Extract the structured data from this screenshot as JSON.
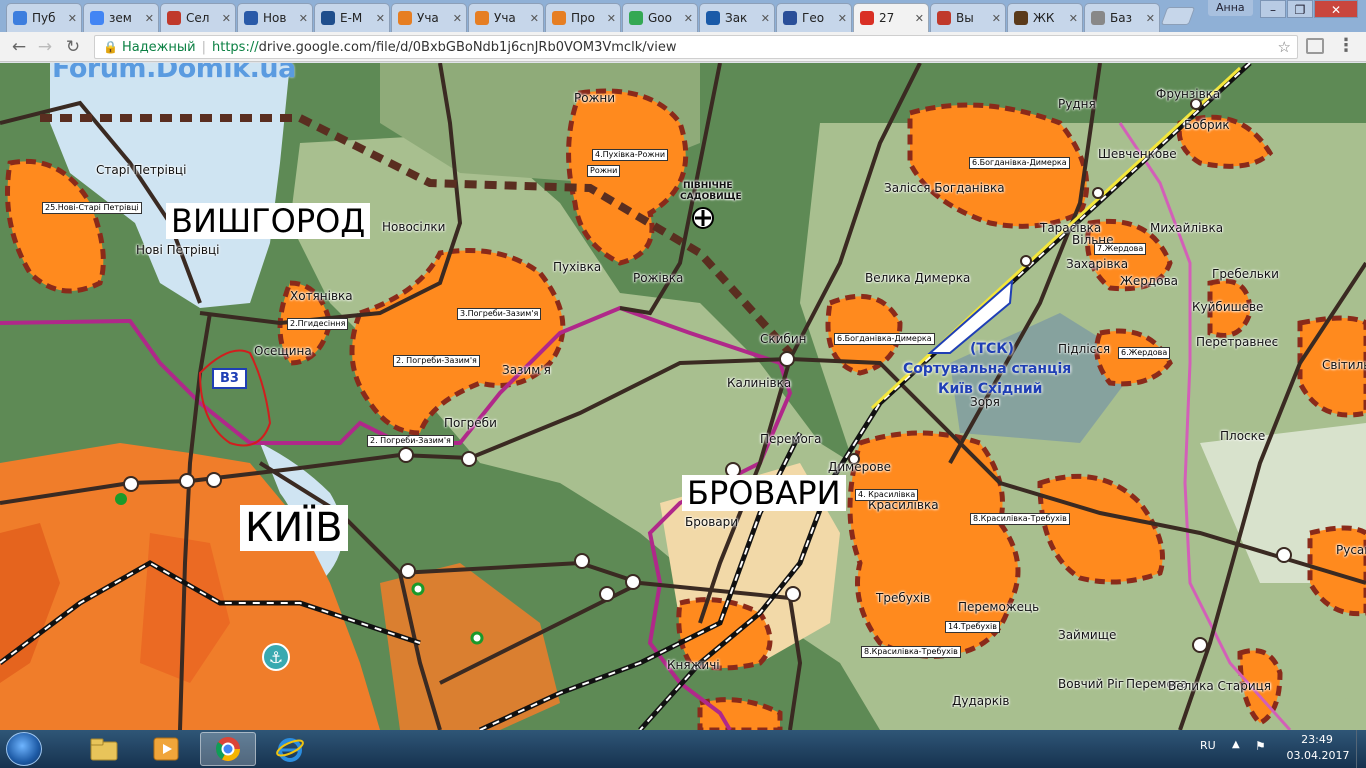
{
  "browser": {
    "tabs": [
      {
        "label": "Пуб",
        "color": "#3d7ede"
      },
      {
        "label": "зем",
        "color": "#4285f4"
      },
      {
        "label": "Сел",
        "color": "#c0392b"
      },
      {
        "label": "Нов",
        "color": "#2a5aa8"
      },
      {
        "label": "E-M",
        "color": "#1f4e8c"
      },
      {
        "label": "Уча",
        "color": "#e67e22"
      },
      {
        "label": "Уча",
        "color": "#e67e22"
      },
      {
        "label": "Про",
        "color": "#e67e22"
      },
      {
        "label": "Goo",
        "color": "#34a853"
      },
      {
        "label": "Зак",
        "color": "#1a5aa8"
      },
      {
        "label": "Гео",
        "color": "#2a4f99"
      },
      {
        "label": "27",
        "color": "#d93025"
      },
      {
        "label": "Вы",
        "color": "#c0392b"
      },
      {
        "label": "ЖК",
        "color": "#5a3a1a"
      },
      {
        "label": "Баз",
        "color": "#888888"
      }
    ],
    "active_tab": 11,
    "user": "Анна",
    "window_controls": {
      "minimize": "–",
      "restore": "❐",
      "close": "✕"
    },
    "security_label": "Надежный",
    "url_scheme": "https://",
    "url_rest": "drive.google.com/file/d/0BxbGBoNdb1j6cnJRb0VOM3Vmclk/view",
    "icons": {
      "back": "back-arrow-icon",
      "forward": "forward-arrow-icon",
      "reload": "reload-icon",
      "bookmark": "star-icon",
      "cast": "cast-icon",
      "menu": "menu-icon"
    }
  },
  "map": {
    "watermark": "Forum.Domik.ua",
    "city_labels": {
      "vyshhorod": "ВИШГОРОД",
      "kyiv": "КИЇВ",
      "brovary": "БРОВАРИ"
    },
    "road_badge": "В3",
    "station_labels": {
      "tsk": "(ТСК)",
      "station_line1": "Сортувальна станція",
      "station_line2": "Київ Східний"
    },
    "settlements": {
      "stari_petrivtsi": "Старі Петрівці",
      "novi_petrivtsi": "Нові Петрівці",
      "novosilky": "Новосілки",
      "khotianivka": "Хотянівка",
      "oseshchyna": "Осещина",
      "pukhivka": "Пухівка",
      "rozhny": "Рожни",
      "rozhivka": "Рожівка",
      "zazymia": "Зазим'я",
      "pohreby": "Погреби",
      "kalynivka": "Калинівка",
      "peremoha": "Перемога",
      "brovary": "Бровари",
      "kniazhychi": "Княжичі",
      "skybyn": "Скибин",
      "rudnia": "Рудня",
      "frunzivka": "Фрунзівка",
      "bobryk": "Бобрик",
      "shevchenkove": "Шевченкове",
      "zalissia_bohdanivka": "Залісся Богданівка",
      "velyka_dymerka": "Велика Димерка",
      "tarasivka": "Тарасівка",
      "vilne": "Вільне",
      "zakharivka": "Захарівка",
      "mykhailivka": "Михайлівка",
      "zherdova": "Жердова",
      "hrebelky": "Гребельки",
      "kuibysheve": "Куйбишеве",
      "pidlissia": "Підлісся",
      "peretrovavne": "Перетравнеє",
      "svitylnia": "Світильня",
      "zoria": "Зоря",
      "dymerove": "Димерове",
      "plosk": "Плоске",
      "krasylivka": "Красилівка",
      "trebukhiv": "Требухів",
      "peremozhets": "Переможець",
      "zaimyshche": "Займище",
      "rusaniv": "Русанів",
      "peremoha2": "Перемога",
      "velyka_starytsia": "Велика Стариця",
      "dudarkiv": "Дударків",
      "vovchyi_rih": "Вовчий Ріг",
      "sadovyshche_line1": "ПІВНІЧНЕ",
      "sadovyshche_line2": "САДОВИЩЕ"
    },
    "zone_labels": {
      "z25": "25.Нові-Старі Петрівці",
      "z4a": "4.Пухівка-Рожни",
      "z4b": "Рожни",
      "z3": "3.Погреби-Зазим'я",
      "z2a": "2.Пгидесіння",
      "z2b": "2. Погреби-Зазим'я",
      "z2c": "2. Погреби-Зазим'я",
      "z6a": "6.Богданівка-Димерка",
      "z6b": "6.Богданівка-Димерка",
      "z7": "7.Жердова",
      "z6c": "6.Жердова",
      "z4c": "4. Красилівка",
      "z8a": "8.Красилівка-Требухів",
      "z8b": "8.Красилівка-Требухів",
      "z14": "14.Требухів"
    },
    "colors": {
      "forest": "#5e8a55",
      "field": "#a8bf8f",
      "urban": "#f07d2a",
      "zone_fill": "#ff8a1e",
      "zone_border": "#8a2a1a",
      "water": "#cfe4f2",
      "boundary": "#b0288a",
      "road": "#3a2a22",
      "railway": "#111111"
    }
  },
  "taskbar": {
    "apps": [
      "explorer-icon",
      "media-player-icon",
      "chrome-icon",
      "internet-explorer-icon"
    ],
    "active_app": 2,
    "language": "RU",
    "time": "23:49",
    "date": "03.04.2017"
  }
}
